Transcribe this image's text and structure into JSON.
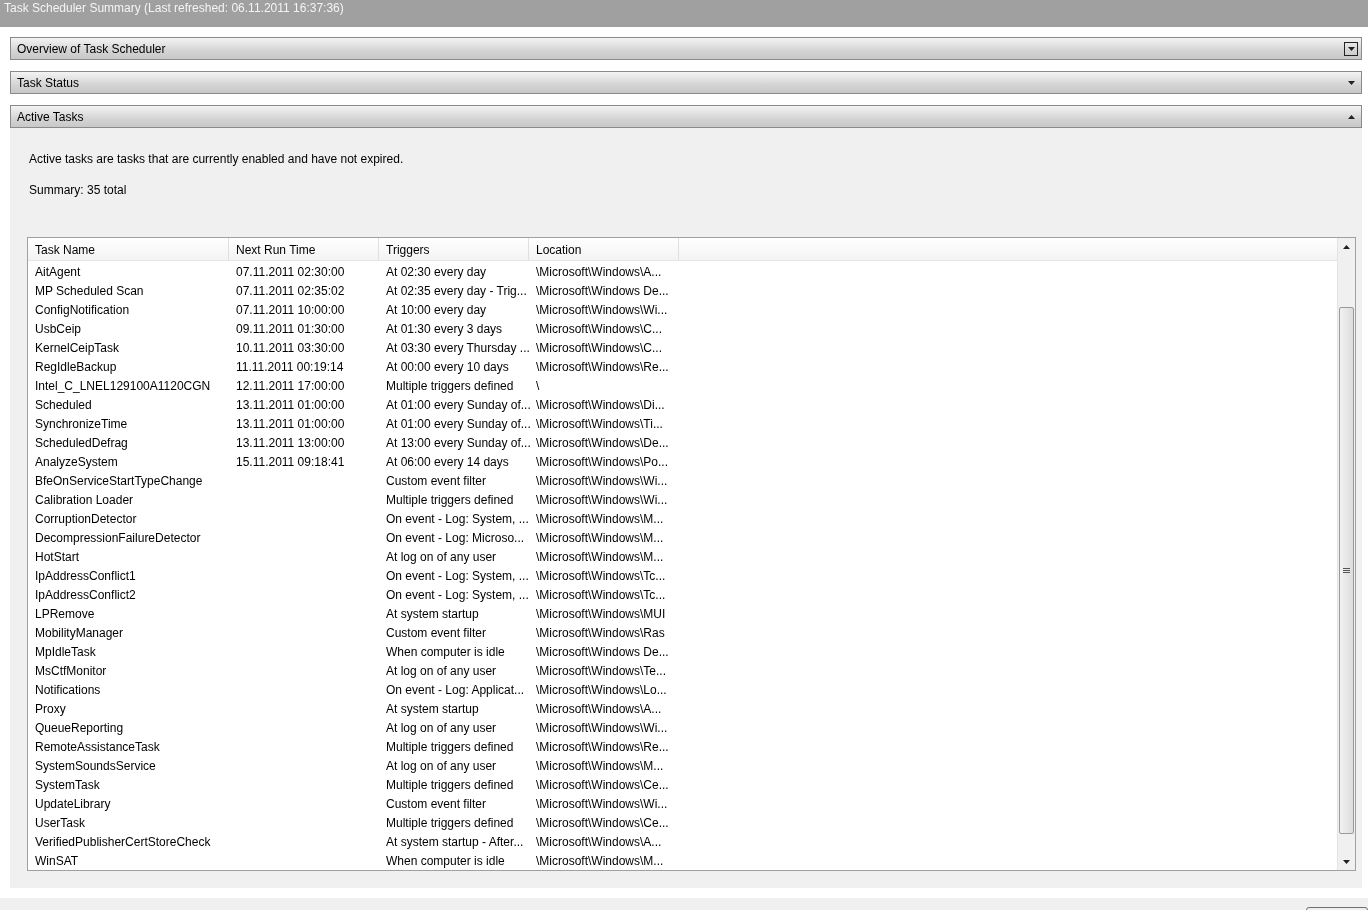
{
  "window": {
    "title": "Task Scheduler Summary (Last refreshed: 06.11.2011 16:37:36)"
  },
  "sections": [
    {
      "title": "Overview of Task Scheduler",
      "expanded": false,
      "focused": true
    },
    {
      "title": "Task Status",
      "expanded": false,
      "focused": false
    },
    {
      "title": "Active Tasks",
      "expanded": true,
      "focused": false
    }
  ],
  "active_tasks": {
    "description": "Active tasks are tasks that are currently enabled and have not expired.",
    "summary": "Summary: 35 total",
    "table": {
      "columns": [
        "Task Name",
        "Next Run Time",
        "Triggers",
        "Location"
      ],
      "rows": [
        [
          "AitAgent",
          "07.11.2011 02:30:00",
          "At 02:30 every day",
          "\\Microsoft\\Windows\\A..."
        ],
        [
          "MP Scheduled Scan",
          "07.11.2011 02:35:02",
          "At 02:35 every day - Trig...",
          "\\Microsoft\\Windows De..."
        ],
        [
          "ConfigNotification",
          "07.11.2011 10:00:00",
          "At 10:00 every day",
          "\\Microsoft\\Windows\\Wi..."
        ],
        [
          "UsbCeip",
          "09.11.2011 01:30:00",
          "At 01:30 every 3 days",
          "\\Microsoft\\Windows\\C..."
        ],
        [
          "KernelCeipTask",
          "10.11.2011 03:30:00",
          "At 03:30 every Thursday ...",
          "\\Microsoft\\Windows\\C..."
        ],
        [
          "RegIdleBackup",
          "11.11.2011 00:19:14",
          "At 00:00 every 10 days",
          "\\Microsoft\\Windows\\Re..."
        ],
        [
          "Intel_C_LNEL129100A1120CGN",
          "12.11.2011 17:00:00",
          "Multiple triggers defined",
          "\\"
        ],
        [
          "Scheduled",
          "13.11.2011 01:00:00",
          "At 01:00 every Sunday of...",
          "\\Microsoft\\Windows\\Di..."
        ],
        [
          "SynchronizeTime",
          "13.11.2011 01:00:00",
          "At 01:00 every Sunday of...",
          "\\Microsoft\\Windows\\Ti..."
        ],
        [
          "ScheduledDefrag",
          "13.11.2011 13:00:00",
          "At 13:00 every Sunday of...",
          "\\Microsoft\\Windows\\De..."
        ],
        [
          "AnalyzeSystem",
          "15.11.2011 09:18:41",
          "At 06:00 every 14 days",
          "\\Microsoft\\Windows\\Po..."
        ],
        [
          "BfeOnServiceStartTypeChange",
          "",
          "Custom event filter",
          "\\Microsoft\\Windows\\Wi..."
        ],
        [
          "Calibration Loader",
          "",
          "Multiple triggers defined",
          "\\Microsoft\\Windows\\Wi..."
        ],
        [
          "CorruptionDetector",
          "",
          "On event - Log: System, ...",
          "\\Microsoft\\Windows\\M..."
        ],
        [
          "DecompressionFailureDetector",
          "",
          "On event - Log: Microso...",
          "\\Microsoft\\Windows\\M..."
        ],
        [
          "HotStart",
          "",
          "At log on of any user",
          "\\Microsoft\\Windows\\M..."
        ],
        [
          "IpAddressConflict1",
          "",
          "On event - Log: System, ...",
          "\\Microsoft\\Windows\\Tc..."
        ],
        [
          "IpAddressConflict2",
          "",
          "On event - Log: System, ...",
          "\\Microsoft\\Windows\\Tc..."
        ],
        [
          "LPRemove",
          "",
          "At system startup",
          "\\Microsoft\\Windows\\MUI"
        ],
        [
          "MobilityManager",
          "",
          "Custom event filter",
          "\\Microsoft\\Windows\\Ras"
        ],
        [
          "MpIdleTask",
          "",
          "When computer is idle",
          "\\Microsoft\\Windows De..."
        ],
        [
          "MsCtfMonitor",
          "",
          "At log on of any user",
          "\\Microsoft\\Windows\\Te..."
        ],
        [
          "Notifications",
          "",
          "On event - Log: Applicat...",
          "\\Microsoft\\Windows\\Lo..."
        ],
        [
          "Proxy",
          "",
          "At system startup",
          "\\Microsoft\\Windows\\A..."
        ],
        [
          "QueueReporting",
          "",
          "At log on of any user",
          "\\Microsoft\\Windows\\Wi..."
        ],
        [
          "RemoteAssistanceTask",
          "",
          "Multiple triggers defined",
          "\\Microsoft\\Windows\\Re..."
        ],
        [
          "SystemSoundsService",
          "",
          "At log on of any user",
          "\\Microsoft\\Windows\\M..."
        ],
        [
          "SystemTask",
          "",
          "Multiple triggers defined",
          "\\Microsoft\\Windows\\Ce..."
        ],
        [
          "UpdateLibrary",
          "",
          "Custom event filter",
          "\\Microsoft\\Windows\\Wi..."
        ],
        [
          "UserTask",
          "",
          "Multiple triggers defined",
          "\\Microsoft\\Windows\\Ce..."
        ],
        [
          "VerifiedPublisherCertStoreCheck",
          "",
          "At system startup - After...",
          "\\Microsoft\\Windows\\A..."
        ],
        [
          "WinSAT",
          "",
          "When computer is idle",
          "\\Microsoft\\Windows\\M..."
        ]
      ]
    }
  }
}
